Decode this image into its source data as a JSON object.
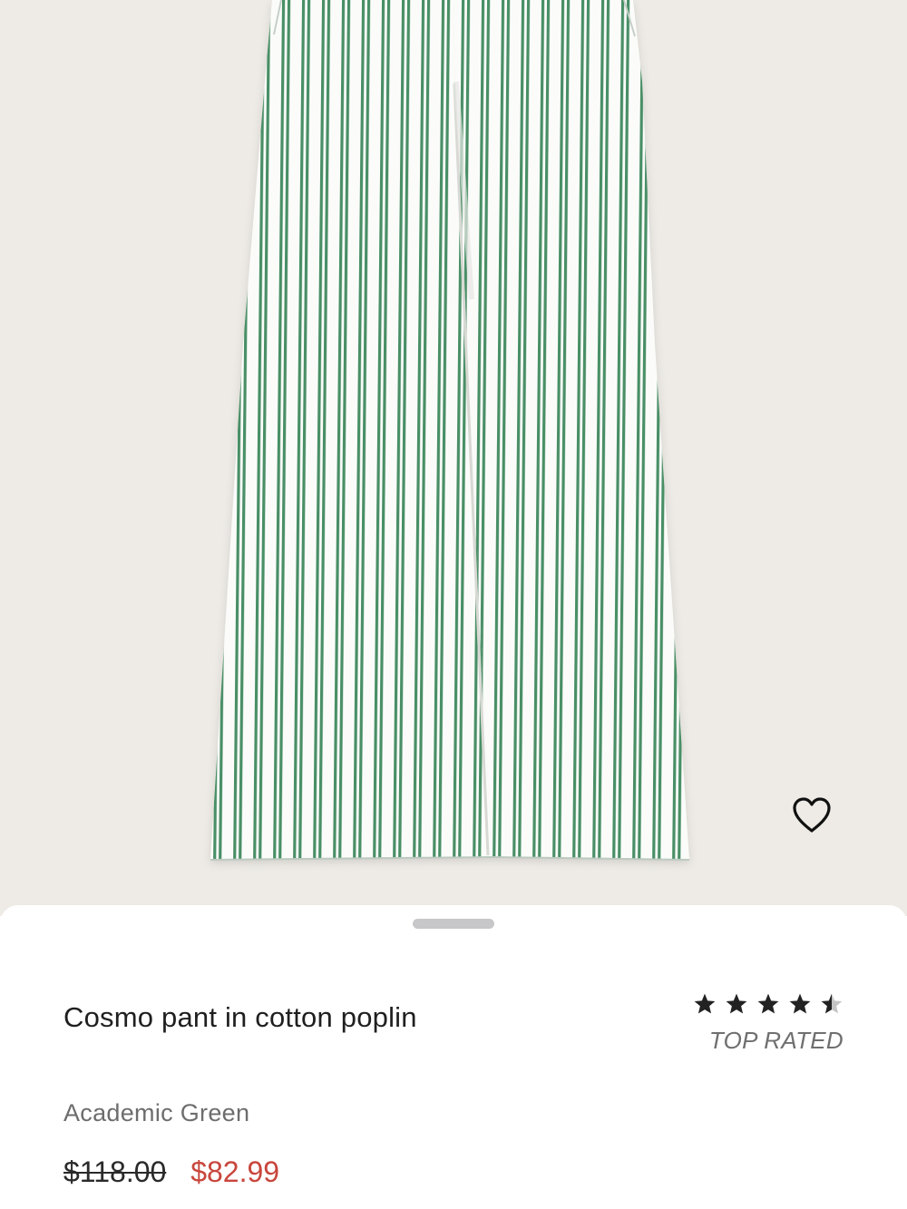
{
  "product": {
    "title": "Cosmo pant in cotton poplin",
    "color_name": "Academic Green",
    "price_original": "$118.00",
    "price_sale": "$82.99",
    "rating": 4.5,
    "rating_max": 5,
    "rating_label": "TOP RATED",
    "image": {
      "subject": "green and white striped wide-leg pants",
      "stripe_color": "#4a8f66",
      "fabric_color": "#fbfcfa",
      "background_color": "#eeebe6"
    }
  },
  "icons": {
    "favorite": "heart-outline-icon",
    "star": "star-icon"
  },
  "colors": {
    "sale": "#c8463c",
    "star_filled": "#222222",
    "star_empty": "#c4c4c4"
  }
}
